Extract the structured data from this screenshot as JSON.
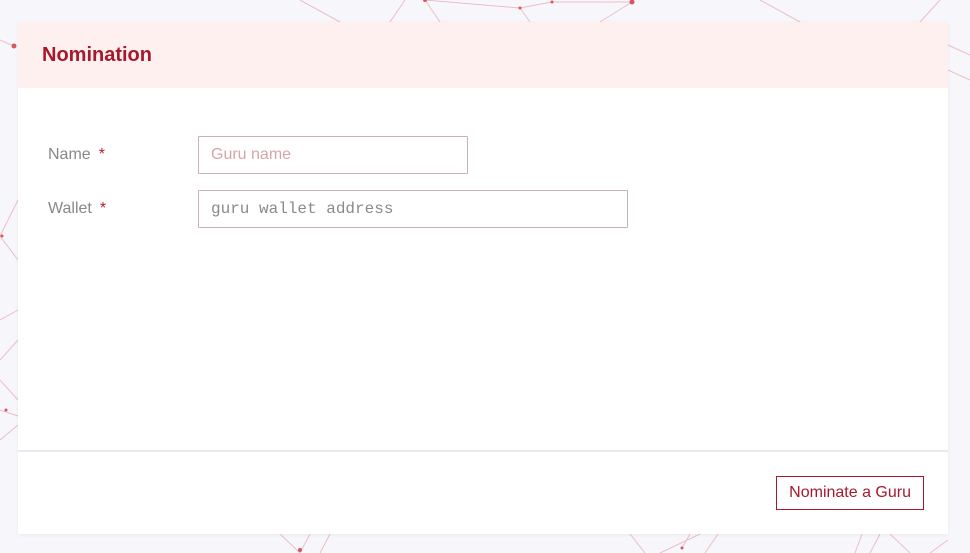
{
  "theme": {
    "accent": "#a8182c",
    "header_bg": "#fff0f0",
    "page_bg": "#f7f7fb"
  },
  "card": {
    "title": "Nomination"
  },
  "form": {
    "name": {
      "label": "Name",
      "required_mark": "*",
      "placeholder": "Guru name",
      "value": ""
    },
    "wallet": {
      "label": "Wallet",
      "required_mark": "*",
      "placeholder": "guru wallet address",
      "value": ""
    }
  },
  "footer": {
    "submit_label": "Nominate a Guru"
  }
}
